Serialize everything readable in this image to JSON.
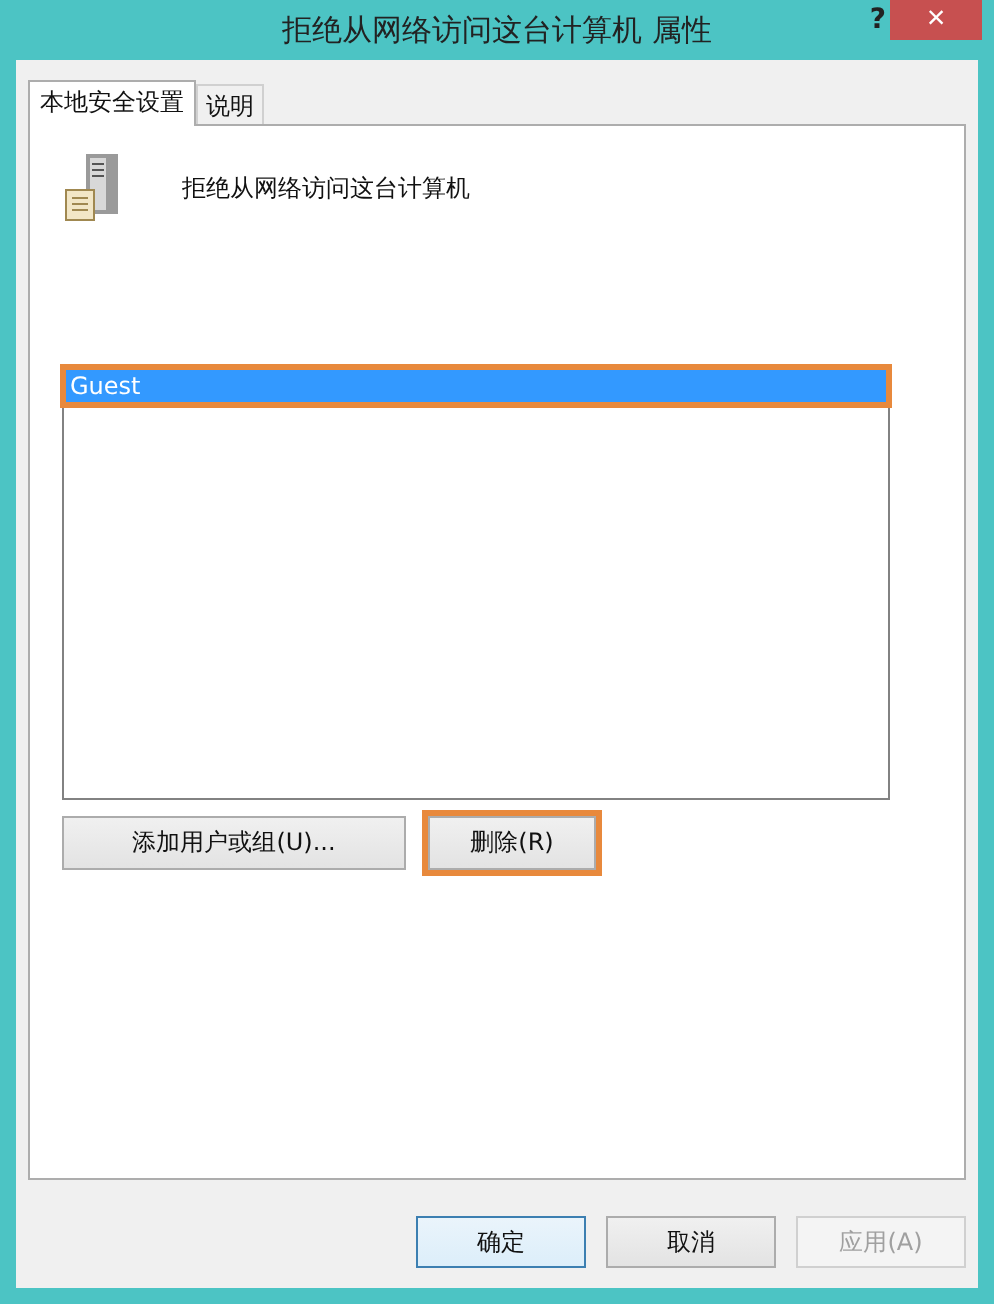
{
  "window": {
    "title": "拒绝从网络访问这台计算机 属性",
    "help": "?",
    "close": "×"
  },
  "tabs": [
    {
      "label": "本地安全设置",
      "selected": true
    },
    {
      "label": "说明",
      "selected": false
    }
  ],
  "policy": {
    "name": "拒绝从网络访问这台计算机"
  },
  "accounts": [
    {
      "name": "Guest",
      "selected": true,
      "highlighted": true
    }
  ],
  "list_buttons": [
    {
      "label": "添加用户或组(U)...",
      "highlighted": false
    },
    {
      "label": "删除(R)",
      "highlighted": true
    }
  ],
  "dialog_buttons": [
    {
      "label": "确定",
      "default": true,
      "disabled": false
    },
    {
      "label": "取消",
      "default": false,
      "disabled": false
    },
    {
      "label": "应用(A)",
      "default": false,
      "disabled": true
    }
  ]
}
